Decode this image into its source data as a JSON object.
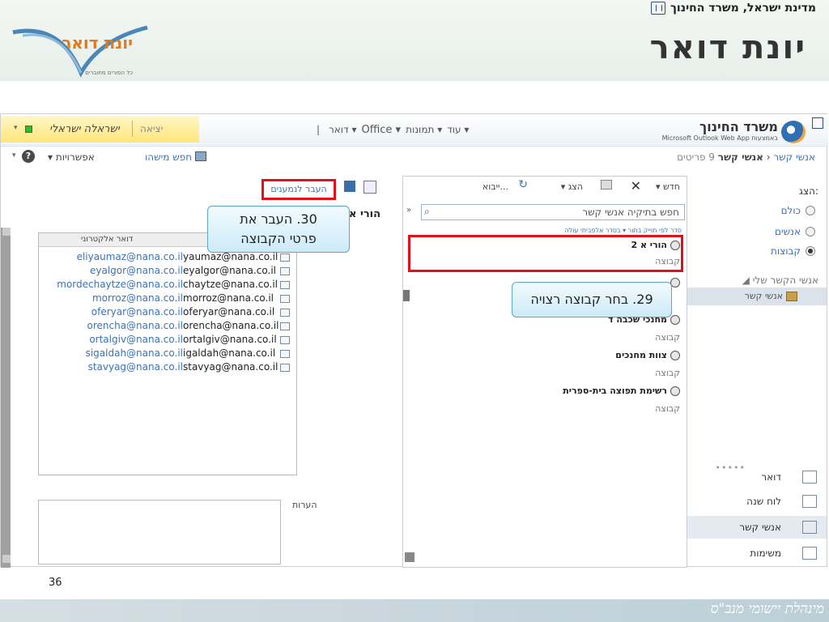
{
  "slide": {
    "ministry": "מדינת ישראל, משרד החינוך",
    "title": "יונת דואר",
    "logo_text": "יונת דואר",
    "logo_tagline": "כל הסורים מחוברים",
    "page_number": "36",
    "footer": "מינהלת יישומי מנב\"ס"
  },
  "owa": {
    "user_name": "ישראלה ישראלי",
    "exit": "יציאה",
    "nav": [
      "דואר",
      "Office",
      "תמונות",
      "עוד"
    ],
    "brand_title": "משרד החינוך",
    "brand_sub": "Microsoft Outlook Web App באמצעות",
    "breadcrumb": {
      "root": "אנשי קשר",
      "current": "אנשי קשר",
      "count": "9 פריטים"
    },
    "find_person": "חפש מישהו",
    "options": "אפשרויות"
  },
  "leftnav": {
    "show_label": "הצג:",
    "filters": [
      {
        "label": "כולם",
        "selected": false
      },
      {
        "label": "אנשים",
        "selected": false
      },
      {
        "label": "קבוצות",
        "selected": true
      }
    ],
    "my_contacts": "אנשי הקשר שלי",
    "contacts_folder": "אנשי קשר",
    "modules": [
      "דואר",
      "לוח שנה",
      "אנשי קשר",
      "משימות"
    ]
  },
  "midpane": {
    "toolbar": {
      "new": "חדש",
      "delete": "✕",
      "view": "הצג",
      "import": "ייבוא..."
    },
    "search_placeholder": "חפש בתיקיה אנשי קשר",
    "sort": "סדר לפי תוייק בתור  ▾  בסדר אלפביתי עולה",
    "groups": [
      {
        "name": "הורי א 2",
        "type": "קבוצה"
      },
      {
        "name": "",
        "type": ""
      },
      {
        "name": "מחנכי שכבה ד",
        "type": "קבוצה"
      },
      {
        "name": "צוות מחנכים",
        "type": "קבוצה"
      },
      {
        "name": "רשימת תפוצה בית-ספרית",
        "type": "קבוצה"
      }
    ]
  },
  "detail": {
    "move_to_recipients": "העבר לנמענים",
    "group_title": "הורי א",
    "email_header": "דואר אלקטרוני",
    "emails": [
      "eliyaumaz@nana.co.il",
      "eyalgor@nana.co.il",
      "mordechaytze@nana.co.il",
      "morroz@nana.co.il",
      "oferyar@nana.co.il",
      "orencha@nana.co.il",
      "ortalgiv@nana.co.il",
      "sigaldah@nana.co.il",
      "stavyag@nana.co.il"
    ],
    "display_names": [
      "yaumaz@nana.co.il",
      "eyalgor@nana.co.il",
      "chaytze@nana.co.il",
      "morroz@nana.co.il",
      "oferyar@nana.co.il",
      "orencha@nana.co.il",
      "ortalgiv@nana.co.il",
      "igaldah@nana.co.il",
      "stavyag@nana.co.il"
    ],
    "notes_label": "הערות"
  },
  "callouts": {
    "step30_line1": "30. העבר את",
    "step30_line2": "פרטי הקבוצה",
    "step29": "29. בחר קבוצה רצויה"
  },
  "colors": {
    "accent_red": "#e0101b",
    "link_blue": "#3a72b8",
    "callout_border": "#5aa6cf"
  }
}
